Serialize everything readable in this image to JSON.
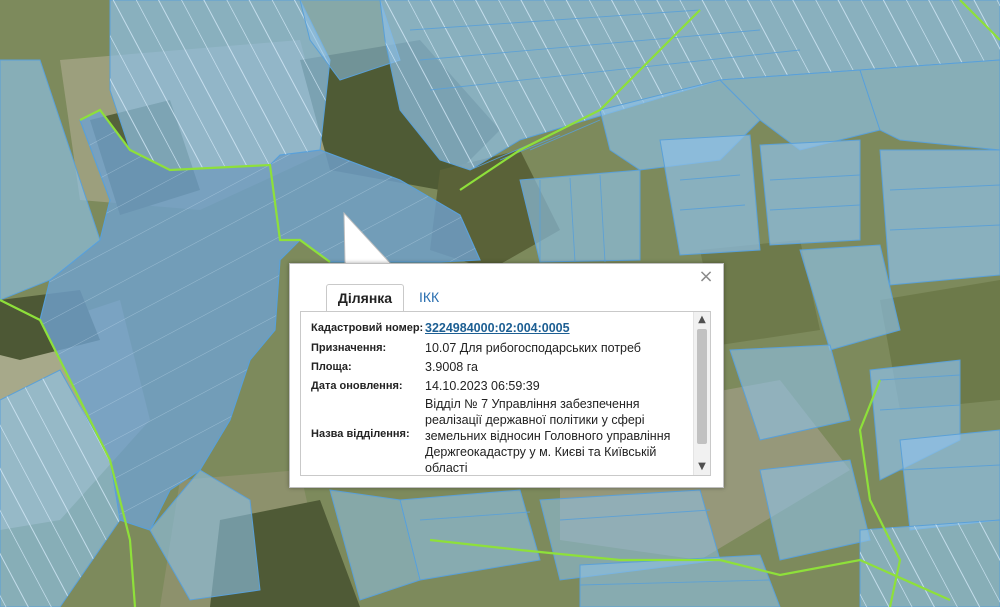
{
  "map": {
    "colors": {
      "imagery_green": "#7d8a5c",
      "field_light": "#a7a98a",
      "forest_dark": "#4f5b35",
      "parcel_fill": "#8ec1e8",
      "parcel_stroke": "#5aa0d8",
      "parcel_hatch": "#cfe6f6",
      "boundary_green": "#8ee03a"
    }
  },
  "popup": {
    "close_icon": "close-icon",
    "tabs": [
      {
        "label": "Ділянка",
        "active": true
      },
      {
        "label": "ІКК",
        "active": false
      }
    ],
    "rows": [
      {
        "label": "Кадастровий номер:",
        "value": "3224984000:02:004:0005"
      },
      {
        "label": "Призначення:",
        "value": "10.07 Для рибогосподарських потреб"
      },
      {
        "label": "Площа:",
        "value": "3.9008 га"
      },
      {
        "label": "Дата оновлення:",
        "value": "14.10.2023 06:59:39"
      },
      {
        "label": "Назва відділення:",
        "value": "Відділ № 7 Управління забезпечення реалізації державної політики у сфері земельних відносин Головного управління Держгеокадастру у м. Києві та Київській області"
      }
    ]
  }
}
